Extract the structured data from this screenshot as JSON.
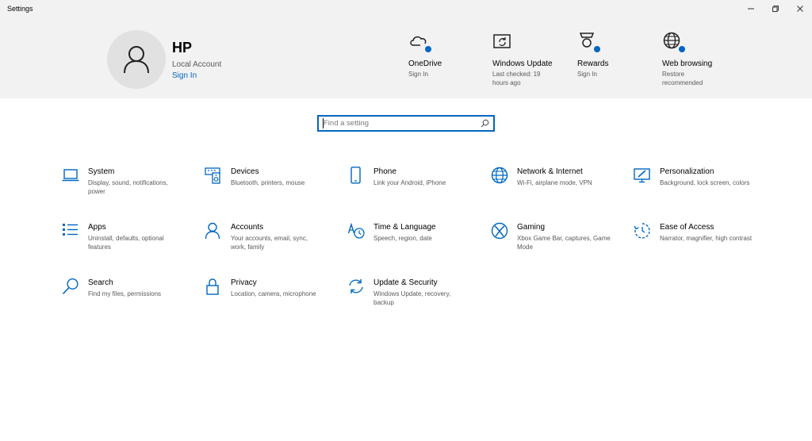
{
  "window": {
    "title": "Settings"
  },
  "user": {
    "name": "HP",
    "account_type": "Local Account",
    "signin_label": "Sign In"
  },
  "quick_links": [
    {
      "id": "onedrive",
      "label": "OneDrive",
      "sub": "Sign In",
      "icon": "cloud-icon"
    },
    {
      "id": "windows-update",
      "label": "Windows Update",
      "sub": "Last checked: 19 hours ago",
      "icon": "update-icon"
    },
    {
      "id": "rewards",
      "label": "Rewards",
      "sub": "Sign In",
      "icon": "medal-icon"
    },
    {
      "id": "web-browsing",
      "label": "Web browsing",
      "sub": "Restore recommended",
      "icon": "globe-icon"
    }
  ],
  "search": {
    "placeholder": "Find a setting",
    "value": ""
  },
  "categories": [
    {
      "id": "system",
      "title": "System",
      "desc": "Display, sound, notifications, power",
      "icon": "laptop-icon"
    },
    {
      "id": "devices",
      "title": "Devices",
      "desc": "Bluetooth, printers, mouse",
      "icon": "devices-icon"
    },
    {
      "id": "phone",
      "title": "Phone",
      "desc": "Link your Android, iPhone",
      "icon": "phone-icon"
    },
    {
      "id": "network",
      "title": "Network & Internet",
      "desc": "Wi-Fi, airplane mode, VPN",
      "icon": "globe-icon"
    },
    {
      "id": "personalization",
      "title": "Personalization",
      "desc": "Background, lock screen, colors",
      "icon": "personalization-icon"
    },
    {
      "id": "apps",
      "title": "Apps",
      "desc": "Uninstall, defaults, optional features",
      "icon": "apps-list-icon"
    },
    {
      "id": "accounts",
      "title": "Accounts",
      "desc": "Your accounts, email, sync, work, family",
      "icon": "person-icon"
    },
    {
      "id": "time-language",
      "title": "Time & Language",
      "desc": "Speech, region, date",
      "icon": "time-language-icon"
    },
    {
      "id": "gaming",
      "title": "Gaming",
      "desc": "Xbox Game Bar, captures, Game Mode",
      "icon": "xbox-icon"
    },
    {
      "id": "ease-of-access",
      "title": "Ease of Access",
      "desc": "Narrator, magnifier, high contrast",
      "icon": "ease-of-access-icon"
    },
    {
      "id": "search",
      "title": "Search",
      "desc": "Find my files, permissions",
      "icon": "search-icon"
    },
    {
      "id": "privacy",
      "title": "Privacy",
      "desc": "Location, camera, microphone",
      "icon": "lock-icon"
    },
    {
      "id": "update-security",
      "title": "Update & Security",
      "desc": "Windows Update, recovery, backup",
      "icon": "sync-icon"
    }
  ],
  "colors": {
    "accent": "#0067c0",
    "header_bg": "#f2f2f2",
    "secondary_text": "#5a5a5a"
  }
}
